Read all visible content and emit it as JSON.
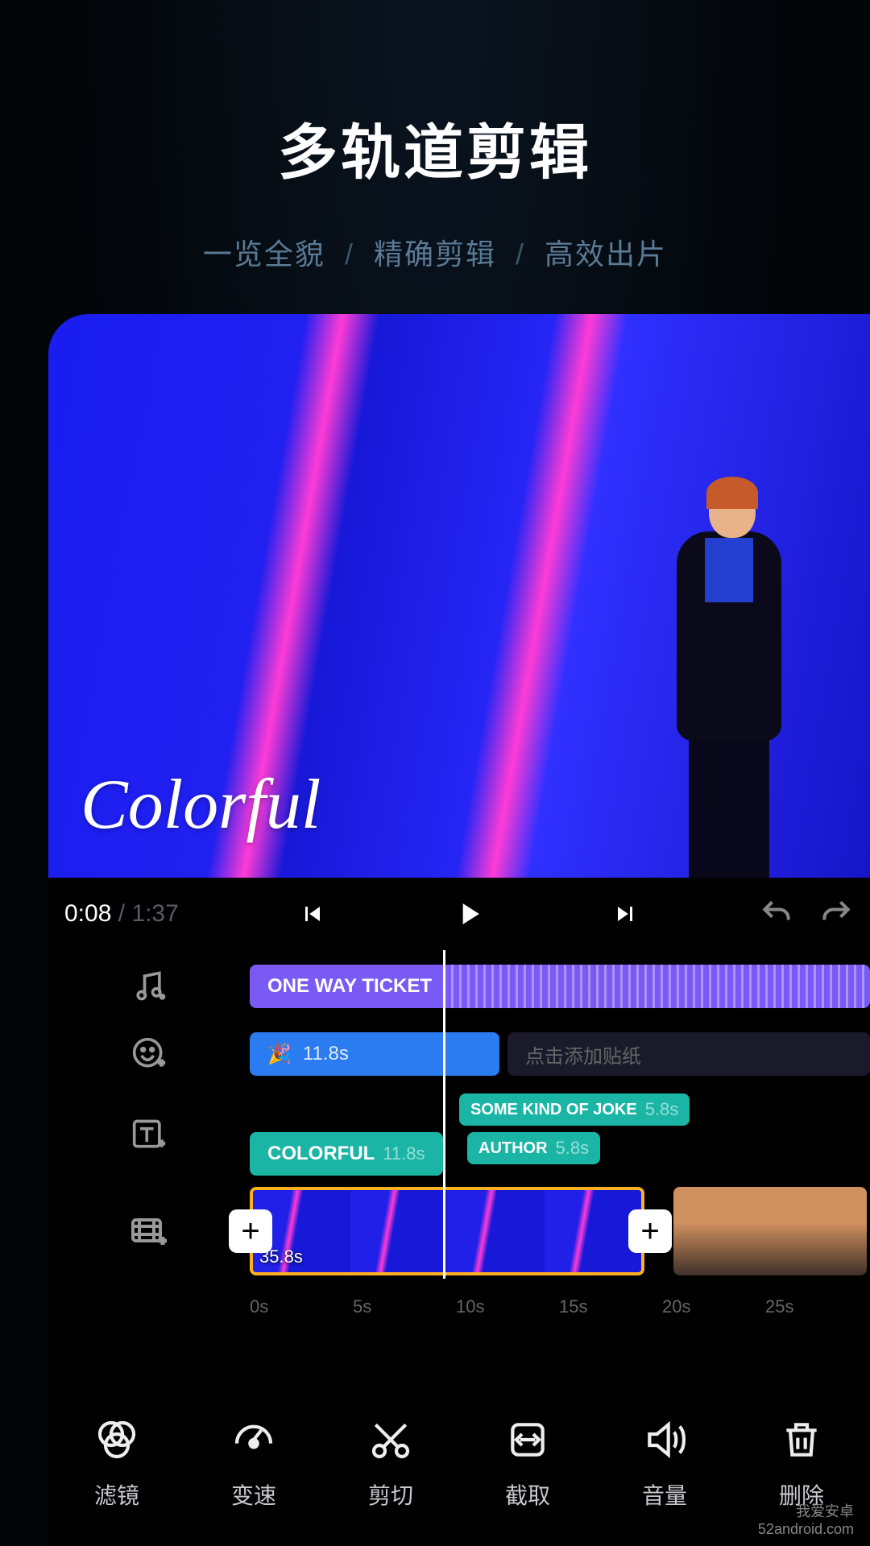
{
  "hero": {
    "title": "多轨道剪辑",
    "sub1": "一览全貌",
    "sub2": "精确剪辑",
    "sub3": "高效出片",
    "sep": "/"
  },
  "preview": {
    "overlay_text": "Colorful"
  },
  "playback": {
    "current": "0:08",
    "sep": " / ",
    "duration": "1:37"
  },
  "tracks": {
    "music": {
      "title": "ONE WAY TICKET"
    },
    "sticker": {
      "emoji": "🎉",
      "duration": "11.8s",
      "hint": "点击添加贴纸"
    },
    "text": {
      "main_label": "COLORFUL",
      "main_dur": "11.8s",
      "t1_label": "SOME KIND OF JOKE",
      "t1_dur": "5.8s",
      "t2_label": "AUTHOR",
      "t2_dur": "5.8s"
    },
    "video": {
      "clip1_dur": "35.8s"
    }
  },
  "ruler": {
    "t0": "0s",
    "t1": "5s",
    "t2": "10s",
    "t3": "15s",
    "t4": "20s",
    "t5": "25s"
  },
  "toolbar": {
    "filter": "滤镜",
    "speed": "变速",
    "cut": "剪切",
    "crop": "截取",
    "volume": "音量",
    "delete": "删除"
  },
  "watermark": {
    "line1": "我爱安卓",
    "line2": "52android.com"
  }
}
